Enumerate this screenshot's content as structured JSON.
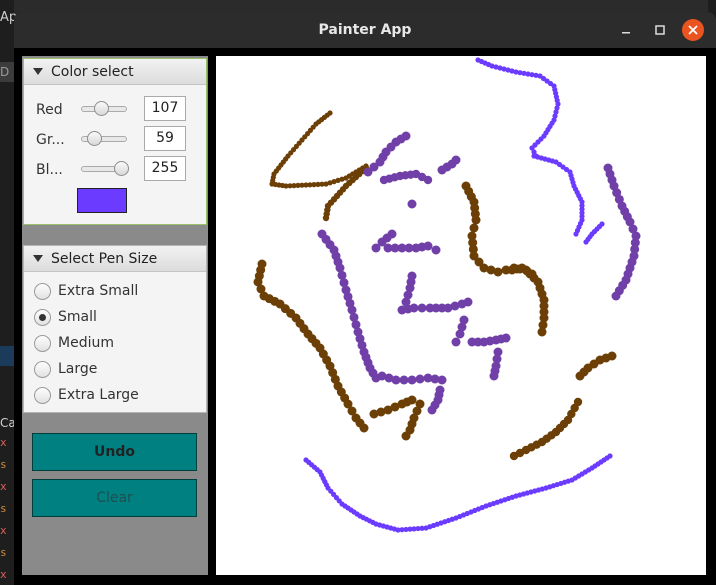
{
  "desktop": {
    "left_top_text": "Ap",
    "left_mid_text": "D",
    "left_bottom_text": "Ca",
    "marks": [
      "x",
      "s",
      "x",
      "s",
      "x",
      "s",
      "x"
    ]
  },
  "window": {
    "title": "Painter App",
    "minimize_label": "–",
    "maximize_label": "□",
    "close_label": "✕"
  },
  "color_select": {
    "title": "Color select",
    "red": {
      "label": "Red",
      "value": "107",
      "level": 0.42
    },
    "green": {
      "label": "Gr...",
      "value": "59",
      "level": 0.23
    },
    "blue": {
      "label": "Bl...",
      "value": "255",
      "level": 1.0
    },
    "swatch_color": "#6b3bff"
  },
  "pen_size": {
    "title": "Select Pen Size",
    "options": [
      {
        "label": "Extra Small",
        "selected": false
      },
      {
        "label": "Small",
        "selected": true
      },
      {
        "label": "Medium",
        "selected": false
      },
      {
        "label": "Large",
        "selected": false
      },
      {
        "label": "Extra Large",
        "selected": false
      }
    ]
  },
  "buttons": {
    "undo": "Undo",
    "clear": "Clear"
  },
  "colors": {
    "brown": "#6b3f05",
    "purple": "#7040a8",
    "blue_purple": "#6b3bff",
    "teal": "#008080"
  }
}
